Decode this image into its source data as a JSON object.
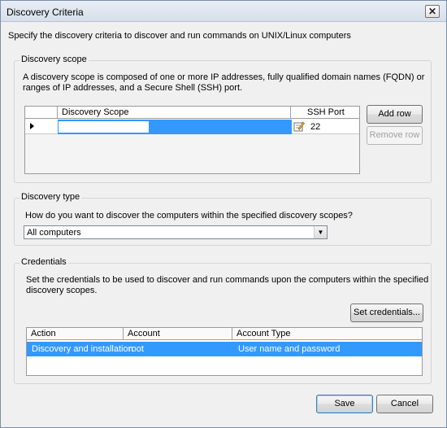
{
  "window": {
    "title": "Discovery Criteria",
    "close_glyph": "✕"
  },
  "intro": "Specify the discovery criteria to discover and run commands on UNIX/Linux computers",
  "scope": {
    "title": "Discovery scope",
    "description_line1": "A discovery scope is composed of one or more IP addresses, fully qualified domain names (FQDN) or",
    "description_line2": "ranges of IP addresses, and a Secure Shell (SSH) port.",
    "columns": [
      "Discovery Scope",
      "SSH Port"
    ],
    "row": {
      "scope_value": "",
      "ssh_port": "22"
    },
    "add_row": "Add row",
    "remove_row": "Remove row"
  },
  "type": {
    "title": "Discovery type",
    "question": "How do you want to discover the computers within the specified discovery scopes?",
    "selected": "All computers"
  },
  "credentials": {
    "title": "Credentials",
    "description_line1": "Set the credentials to be used to discover and run commands upon the computers within the specified",
    "description_line2": "discovery scopes.",
    "set_button": "Set credentials...",
    "columns": [
      "Action",
      "Account",
      "Account Type"
    ],
    "rows": [
      {
        "action": "Discovery and installation",
        "account": "root",
        "account_type": "User name and password"
      }
    ]
  },
  "footer": {
    "save": "Save",
    "cancel": "Cancel"
  },
  "colors": {
    "selection": "#3399ff",
    "titlebar": "#dbe4ef"
  }
}
